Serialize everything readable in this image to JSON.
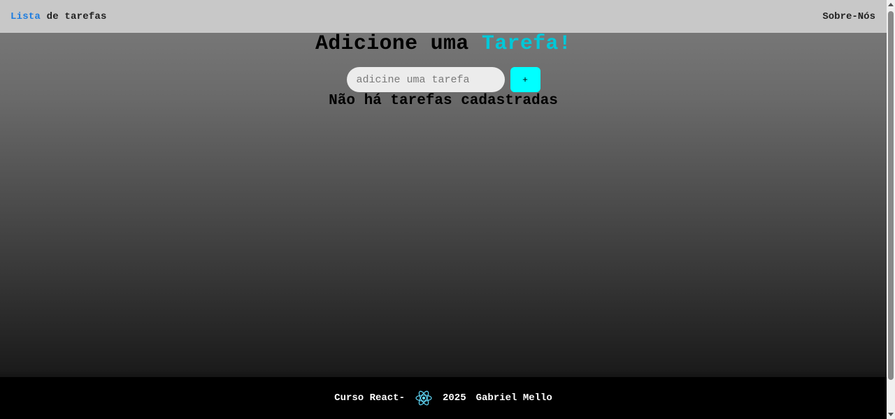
{
  "header": {
    "brand_accent": "Lista",
    "brand_rest": " de tarefas",
    "nav_about": "Sobre-Nós"
  },
  "main": {
    "title_prefix": "Adicione uma ",
    "title_accent": "Tarefa!",
    "input": {
      "value": "",
      "placeholder": "adicine uma tarefa"
    },
    "add_button_label": "+",
    "empty_message": "Não há tarefas cadastradas"
  },
  "footer": {
    "course": "Curso React-",
    "icon": "react-icon",
    "year": "2025",
    "author": "Gabriel Mello"
  },
  "colors": {
    "accent_blue": "#1e7de0",
    "accent_cyan": "#00c8d8",
    "button_bg": "#00ffff",
    "header_bg": "#c8c8c8",
    "footer_bg": "#000000",
    "react_logo": "#61dafb"
  }
}
